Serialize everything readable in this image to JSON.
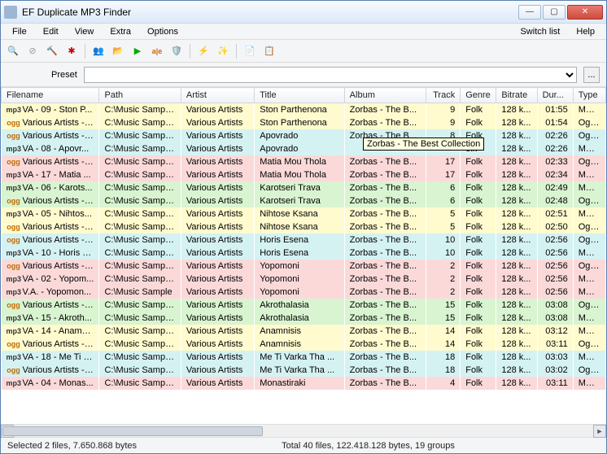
{
  "window": {
    "title": "EF Duplicate MP3 Finder"
  },
  "menu": {
    "file": "File",
    "edit": "Edit",
    "view": "View",
    "extra": "Extra",
    "options": "Options",
    "switch": "Switch list",
    "help": "Help"
  },
  "preset": {
    "label": "Preset",
    "value": "",
    "ellipsis": "..."
  },
  "columns": {
    "filename": "Filename",
    "path": "Path",
    "artist": "Artist",
    "title": "Title",
    "album": "Album",
    "track": "Track",
    "genre": "Genre",
    "bitrate": "Bitrate",
    "duration": "Dur...",
    "type": "Type"
  },
  "tooltip": "Zorbas - The Best Collection",
  "status": {
    "left": "Selected 2 files, 7.650.868 bytes",
    "center": "Total 40 files, 122.418.128 bytes, 19 groups"
  },
  "rows": [
    {
      "fmt": "mp3",
      "color": "yellow",
      "filename": "VA - 09 - Ston P...",
      "path": "C:\\Music Sample...",
      "artist": "Various Artists",
      "title": "Ston Parthenona",
      "album": "Zorbas - The B...",
      "track": "9",
      "genre": "Folk",
      "bitrate": "128 k...",
      "duration": "01:55",
      "type": "MPEG"
    },
    {
      "fmt": "ogg",
      "color": "yellow",
      "filename": "Various Artists - ...",
      "path": "C:\\Music Sample...",
      "artist": "Various Artists",
      "title": "Ston Parthenona",
      "album": "Zorbas - The B...",
      "track": "9",
      "genre": "Folk",
      "bitrate": "128 k...",
      "duration": "01:54",
      "type": "Ogg V"
    },
    {
      "fmt": "ogg",
      "color": "blue",
      "filename": "Various Artists - ...",
      "path": "C:\\Music Sample...",
      "artist": "Various Artists",
      "title": "Apovrado",
      "album": "Zorbas - The B...",
      "track": "8",
      "genre": "Folk",
      "bitrate": "128 k...",
      "duration": "02:26",
      "type": "Ogg V"
    },
    {
      "fmt": "mp3",
      "color": "blue",
      "filename": "VA - 08 - Apovr...",
      "path": "C:\\Music Sample...",
      "artist": "Various Artists",
      "title": "Apovrado",
      "album": "",
      "track": "",
      "genre": "olk",
      "bitrate": "128 k...",
      "duration": "02:26",
      "type": "MPEG"
    },
    {
      "fmt": "ogg",
      "color": "pink",
      "filename": "Various Artists - ...",
      "path": "C:\\Music Sample...",
      "artist": "Various Artists",
      "title": "Matia Mou Thola",
      "album": "Zorbas - The B...",
      "track": "17",
      "genre": "Folk",
      "bitrate": "128 k...",
      "duration": "02:33",
      "type": "Ogg V"
    },
    {
      "fmt": "mp3",
      "color": "pink",
      "filename": "VA - 17 - Matia ...",
      "path": "C:\\Music Sample...",
      "artist": "Various Artists",
      "title": "Matia Mou Thola",
      "album": "Zorbas - The B...",
      "track": "17",
      "genre": "Folk",
      "bitrate": "128 k...",
      "duration": "02:34",
      "type": "MPEG"
    },
    {
      "fmt": "mp3",
      "color": "green",
      "filename": "VA - 06 - Karots...",
      "path": "C:\\Music Sample...",
      "artist": "Various Artists",
      "title": "Karotseri Trava",
      "album": "Zorbas - The B...",
      "track": "6",
      "genre": "Folk",
      "bitrate": "128 k...",
      "duration": "02:49",
      "type": "MPEG"
    },
    {
      "fmt": "ogg",
      "color": "green",
      "filename": "Various Artists - ...",
      "path": "C:\\Music Sample...",
      "artist": "Various Artists",
      "title": "Karotseri Trava",
      "album": "Zorbas - The B...",
      "track": "6",
      "genre": "Folk",
      "bitrate": "128 k...",
      "duration": "02:48",
      "type": "Ogg V"
    },
    {
      "fmt": "mp3",
      "color": "yellow",
      "filename": "VA - 05 - Nihtos...",
      "path": "C:\\Music Sample...",
      "artist": "Various Artists",
      "title": "Nihtose Ksana",
      "album": "Zorbas - The B...",
      "track": "5",
      "genre": "Folk",
      "bitrate": "128 k...",
      "duration": "02:51",
      "type": "MPEG"
    },
    {
      "fmt": "ogg",
      "color": "yellow",
      "filename": "Various Artists - ...",
      "path": "C:\\Music Sample...",
      "artist": "Various Artists",
      "title": "Nihtose Ksana",
      "album": "Zorbas - The B...",
      "track": "5",
      "genre": "Folk",
      "bitrate": "128 k...",
      "duration": "02:50",
      "type": "Ogg V"
    },
    {
      "fmt": "ogg",
      "color": "blue",
      "filename": "Various Artists - ...",
      "path": "C:\\Music Sample...",
      "artist": "Various Artists",
      "title": "Horis Esena",
      "album": "Zorbas - The B...",
      "track": "10",
      "genre": "Folk",
      "bitrate": "128 k...",
      "duration": "02:56",
      "type": "Ogg V"
    },
    {
      "fmt": "mp3",
      "color": "blue",
      "filename": "VA - 10 - Horis E...",
      "path": "C:\\Music Sample...",
      "artist": "Various Artists",
      "title": "Horis Esena",
      "album": "Zorbas - The B...",
      "track": "10",
      "genre": "Folk",
      "bitrate": "128 k...",
      "duration": "02:56",
      "type": "MPEG"
    },
    {
      "fmt": "ogg",
      "color": "pink",
      "filename": "Various Artists - ...",
      "path": "C:\\Music Sample...",
      "artist": "Various Artists",
      "title": "Yopomoni",
      "album": "Zorbas - The B...",
      "track": "2",
      "genre": "Folk",
      "bitrate": "128 k...",
      "duration": "02:56",
      "type": "Ogg V"
    },
    {
      "fmt": "mp3",
      "color": "pink",
      "filename": "VA - 02 - Yopom...",
      "path": "C:\\Music Sample...",
      "artist": "Various Artists",
      "title": "Yopomoni",
      "album": "Zorbas - The B...",
      "track": "2",
      "genre": "Folk",
      "bitrate": "128 k...",
      "duration": "02:56",
      "type": "MPEG"
    },
    {
      "fmt": "mp3",
      "color": "pink",
      "filename": "V.A. - Yopomon...",
      "path": "C:\\Music Sample",
      "artist": "Various Artists",
      "title": "Yopomoni",
      "album": "Zorbas - The B...",
      "track": "2",
      "genre": "Folk",
      "bitrate": "128 k...",
      "duration": "02:56",
      "type": "MPEG"
    },
    {
      "fmt": "ogg",
      "color": "green",
      "filename": "Various Artists - ...",
      "path": "C:\\Music Sample...",
      "artist": "Various Artists",
      "title": "Akrothalasia",
      "album": "Zorbas - The B...",
      "track": "15",
      "genre": "Folk",
      "bitrate": "128 k...",
      "duration": "03:08",
      "type": "Ogg V"
    },
    {
      "fmt": "mp3",
      "color": "green",
      "filename": "VA - 15 - Akroth...",
      "path": "C:\\Music Sample...",
      "artist": "Various Artists",
      "title": "Akrothalasia",
      "album": "Zorbas - The B...",
      "track": "15",
      "genre": "Folk",
      "bitrate": "128 k...",
      "duration": "03:08",
      "type": "MPEG"
    },
    {
      "fmt": "mp3",
      "color": "yellow",
      "filename": "VA - 14 - Anamn...",
      "path": "C:\\Music Sample...",
      "artist": "Various Artists",
      "title": "Anamnisis",
      "album": "Zorbas - The B...",
      "track": "14",
      "genre": "Folk",
      "bitrate": "128 k...",
      "duration": "03:12",
      "type": "MPEG"
    },
    {
      "fmt": "ogg",
      "color": "yellow",
      "filename": "Various Artists - ...",
      "path": "C:\\Music Sample...",
      "artist": "Various Artists",
      "title": "Anamnisis",
      "album": "Zorbas - The B...",
      "track": "14",
      "genre": "Folk",
      "bitrate": "128 k...",
      "duration": "03:11",
      "type": "Ogg V"
    },
    {
      "fmt": "mp3",
      "color": "blue",
      "filename": "VA - 18 - Me Ti V...",
      "path": "C:\\Music Sample...",
      "artist": "Various Artists",
      "title": "Me Ti Varka Tha ...",
      "album": "Zorbas - The B...",
      "track": "18",
      "genre": "Folk",
      "bitrate": "128 k...",
      "duration": "03:03",
      "type": "MPEG"
    },
    {
      "fmt": "ogg",
      "color": "blue",
      "filename": "Various Artists - ...",
      "path": "C:\\Music Sample...",
      "artist": "Various Artists",
      "title": "Me Ti Varka Tha ...",
      "album": "Zorbas - The B...",
      "track": "18",
      "genre": "Folk",
      "bitrate": "128 k...",
      "duration": "03:02",
      "type": "Ogg V"
    },
    {
      "fmt": "mp3",
      "color": "pink",
      "filename": "VA - 04 - Monas...",
      "path": "C:\\Music Sample...",
      "artist": "Various Artists",
      "title": "Monastiraki",
      "album": "Zorbas - The B...",
      "track": "4",
      "genre": "Folk",
      "bitrate": "128 k...",
      "duration": "03:11",
      "type": "MPEG"
    }
  ],
  "toolbar_icons": [
    "search",
    "stop",
    "hammer",
    "sparkle",
    "people",
    "folder-play",
    "play",
    "ale",
    "shield",
    "sep",
    "bolt",
    "spark",
    "sep",
    "doc",
    "list"
  ]
}
